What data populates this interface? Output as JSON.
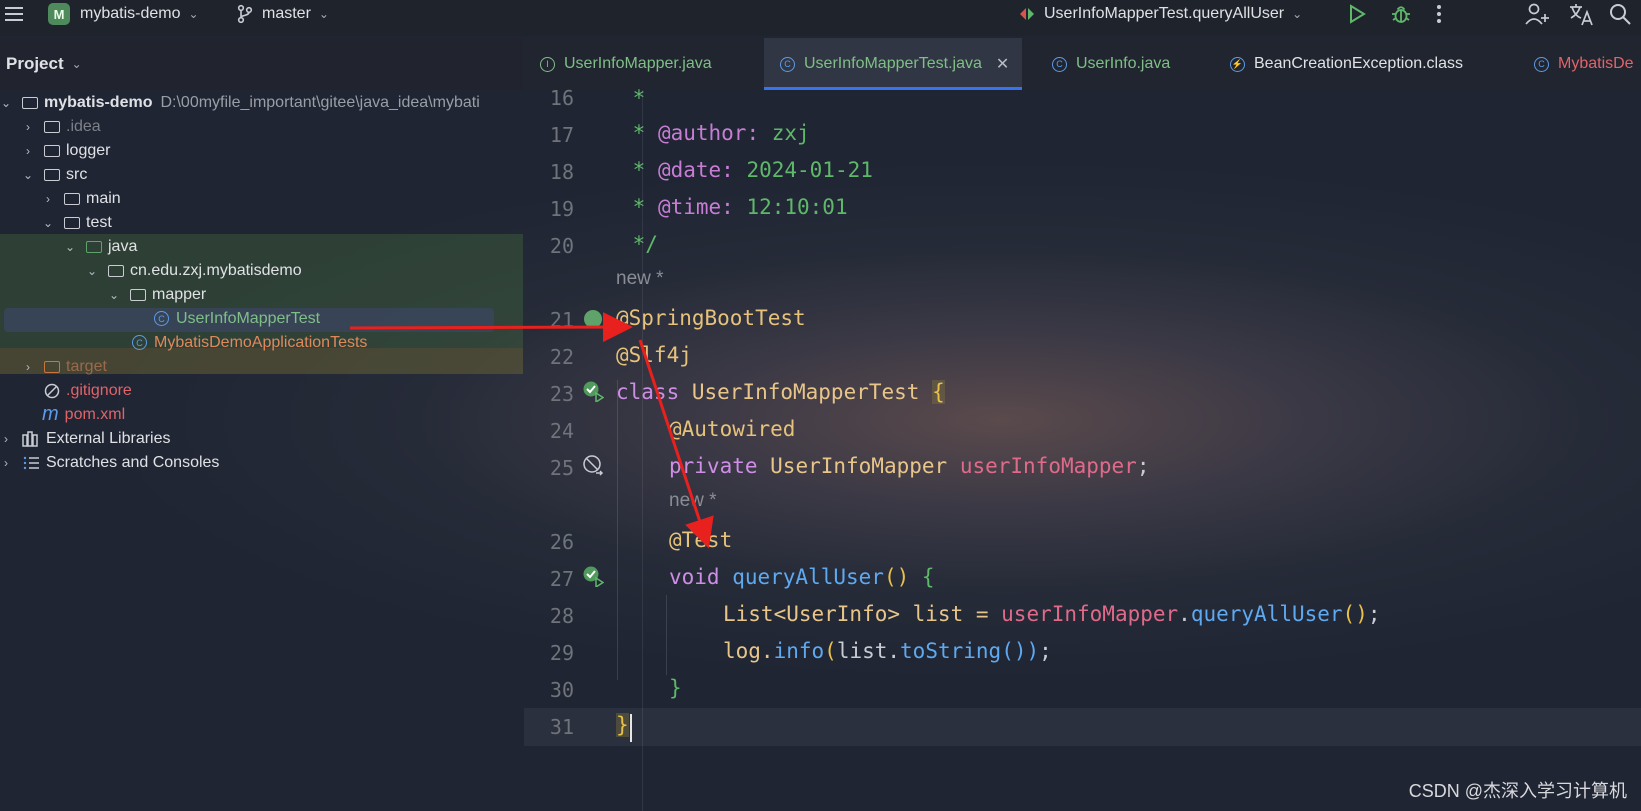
{
  "toolbar": {
    "project_badge": "M",
    "project_name": "mybatis-demo",
    "branch": "master",
    "run_config": "UserInfoMapperTest.queryAllUser"
  },
  "project_panel": {
    "title": "Project"
  },
  "tabs": [
    {
      "label": "UserInfoMapper.java",
      "icon": "interface-icon",
      "active": false
    },
    {
      "label": "UserInfoMapperTest.java",
      "icon": "class-icon",
      "active": true
    },
    {
      "label": "UserInfo.java",
      "icon": "class-icon",
      "active": false
    },
    {
      "label": "BeanCreationException.class",
      "icon": "exception-class-icon",
      "active": false
    },
    {
      "label": "MybatisDe",
      "icon": "class-icon",
      "active": false
    }
  ],
  "tree": [
    {
      "label": "mybatis-demo",
      "path": "D:\\00myfile_important\\gitee\\java_idea\\mybati"
    },
    {
      "label": ".idea"
    },
    {
      "label": "logger"
    },
    {
      "label": "src"
    },
    {
      "label": "main"
    },
    {
      "label": "test"
    },
    {
      "label": "java"
    },
    {
      "label": "cn.edu.zxj.mybatisdemo"
    },
    {
      "label": "mapper"
    },
    {
      "label": "UserInfoMapperTest"
    },
    {
      "label": "MybatisDemoApplicationTests"
    },
    {
      "label": "target"
    },
    {
      "label": ".gitignore"
    },
    {
      "label": "pom.xml"
    },
    {
      "label": "External Libraries"
    },
    {
      "label": "Scratches and Consoles"
    }
  ],
  "editor": {
    "line_numbers": [
      "16",
      "17",
      "18",
      "19",
      "20",
      "21",
      "22",
      "23",
      "24",
      "25",
      "26",
      "27",
      "28",
      "29",
      "30",
      "31"
    ],
    "hint_new": "new *",
    "code": {
      "l16_star": " *",
      "l17_star": " * ",
      "l17_tag": "@author:",
      "l17_val": " zxj",
      "l18_star": " * ",
      "l18_tag": "@date:",
      "l18_val": " 2024-01-21",
      "l19_star": " * ",
      "l19_tag": "@time:",
      "l19_val": " 12:10:01",
      "l20": " */",
      "l21": "@SpringBootTest",
      "l22": "@Slf4j",
      "l23_kw": "class",
      "l23_name": " UserInfoMapperTest ",
      "l23_brace": "{",
      "l24": "@Autowired",
      "l25_kw": "private",
      "l25_type": " UserInfoMapper ",
      "l25_field": "userInfoMapper",
      "l25_end": ";",
      "l26": "@Test",
      "l27_kw": "void",
      "l27_fn": " queryAllUser",
      "l27_paren": "()",
      "l27_brace": " {",
      "l28_a": "List<UserInfo> list = ",
      "l28_field": "userInfoMapper",
      "l28_dot": ".",
      "l28_fn": "queryAllUser",
      "l28_paren": "()",
      "l28_end": ";",
      "l29_a": "log.",
      "l29_fn": "info",
      "l29_p1": "(",
      "l29_b": "list.",
      "l29_fn2": "toString",
      "l29_p2": "())",
      "l29_end": ";",
      "l30": "}",
      "l31": "}"
    }
  },
  "watermark": "CSDN @杰深入学习计算机"
}
